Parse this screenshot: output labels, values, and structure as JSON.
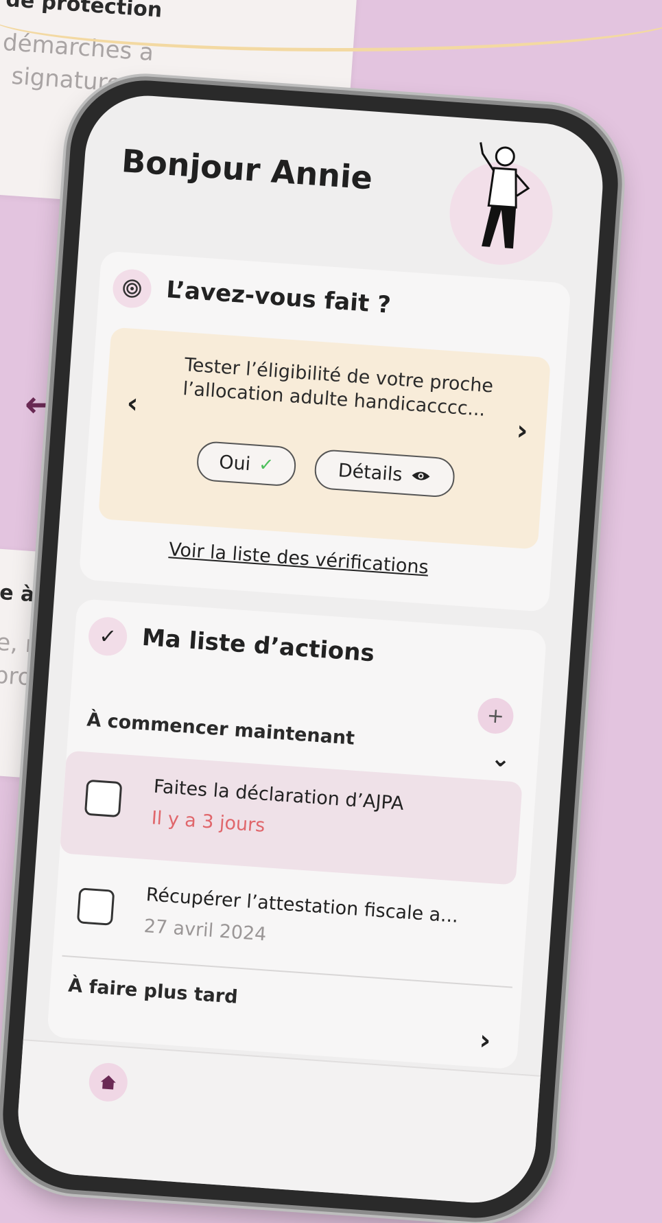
{
  "background": {
    "top_card": {
      "title": "de protection",
      "lines": [
        "démarches a",
        "signature d"
      ]
    },
    "bottom_card": {
      "title": "e à do",
      "lines": [
        "e, rem",
        "proc"
      ]
    }
  },
  "header": {
    "greeting": "Bonjour Annie"
  },
  "checks": {
    "title": "L’avez-vous fait ?",
    "task_text": "Tester l’éligibilité de votre proche l’allocation adulte handicacccc...",
    "yes_label": "Oui",
    "details_label": "Détails",
    "list_link": "Voir la liste des vérifications"
  },
  "actions": {
    "title": "Ma liste d’actions",
    "add_label": "+",
    "section_now": "À commencer maintenant",
    "items": [
      {
        "title": "Faites la déclaration d’AJPA",
        "sub": "Il y a 3 jours",
        "sub_color": "#e0666b"
      },
      {
        "title": "Récupérer l’attestation fiscale a...",
        "sub": "27 avril 2024",
        "sub_color": "#9a9696"
      }
    ],
    "section_later": "À faire plus tard"
  },
  "colors": {
    "accent": "#f2dde8",
    "overdue": "#e0666b",
    "beige": "#f8ecd9",
    "background": "#e3c4df"
  },
  "icons": [
    "target-icon",
    "check-icon",
    "eye-icon",
    "chevron-left-icon",
    "chevron-right-icon",
    "chevron-down-icon",
    "plus-icon",
    "home-icon"
  ]
}
